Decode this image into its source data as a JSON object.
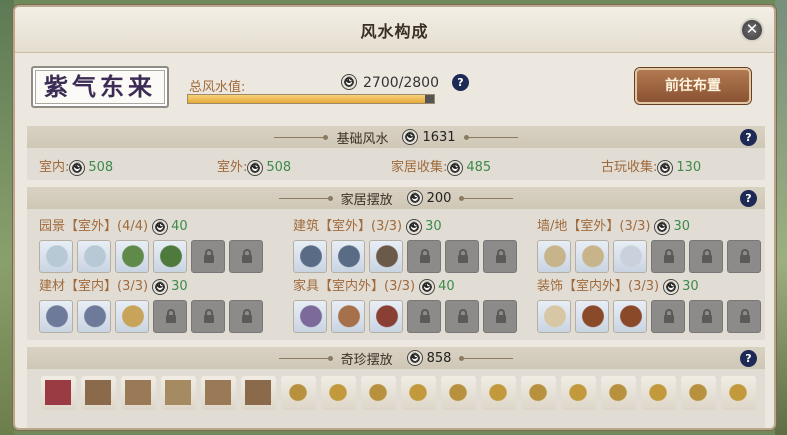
{
  "window": {
    "title": "风水构成",
    "close_icon": "close-icon"
  },
  "summary": {
    "badge_text": "紫气东来",
    "total_label": "总风水值:",
    "total_value": "2700/2800",
    "progress": 0.964,
    "help_icon": "question-icon",
    "goto_button": "前往布置"
  },
  "basic": {
    "title": "基础风水",
    "value": "1631",
    "items": [
      {
        "label": "室内:",
        "value": "508"
      },
      {
        "label": "室外:",
        "value": "508"
      },
      {
        "label": "家居收集:",
        "value": "485"
      },
      {
        "label": "古玩收集:",
        "value": "130"
      }
    ]
  },
  "furniture": {
    "title": "家居摆放",
    "value": "200",
    "groups": [
      {
        "label": "园景【室外】(4/4)",
        "value": "40",
        "filled": 4,
        "slot_colors": [
          "#b8c9d6",
          "#b8c9d6",
          "#5f8a4a",
          "#4f7a3e"
        ]
      },
      {
        "label": "建筑【室外】(3/3)",
        "value": "30",
        "filled": 3,
        "slot_colors": [
          "#5a6b86",
          "#5a6b86",
          "#6b5a4a"
        ]
      },
      {
        "label": "墙/地【室外】(3/3)",
        "value": "30",
        "filled": 3,
        "slot_colors": [
          "#c8b48a",
          "#c8b48a",
          "#c9d2dc"
        ]
      },
      {
        "label": "建材【室内】(3/3)",
        "value": "30",
        "filled": 3,
        "slot_colors": [
          "#6d7a99",
          "#6d7a99",
          "#c8a45a"
        ]
      },
      {
        "label": "家具【室内外】(3/3)",
        "value": "40",
        "filled": 3,
        "slot_colors": [
          "#7b6a9a",
          "#a6704a",
          "#8a3f34"
        ]
      },
      {
        "label": "装饰【室内外】(3/3)",
        "value": "30",
        "filled": 3,
        "slot_colors": [
          "#d8c7a5",
          "#8a4a2a",
          "#8a4a2a"
        ]
      }
    ]
  },
  "curios": {
    "title": "奇珍摆放",
    "value": "858",
    "item_colors": [
      "#9a3a42",
      "#8a6a4a",
      "#9a7a56",
      "#a68a62",
      "#9a7a56",
      "#8a6a4a",
      "#b7913d",
      "#c29a3c",
      "#b7913d",
      "#c29a3c",
      "#b7913d",
      "#c29a3c",
      "#b7913d",
      "#c29a3c",
      "#b7913d",
      "#c29a3c",
      "#b7913d",
      "#c29a3c"
    ]
  }
}
